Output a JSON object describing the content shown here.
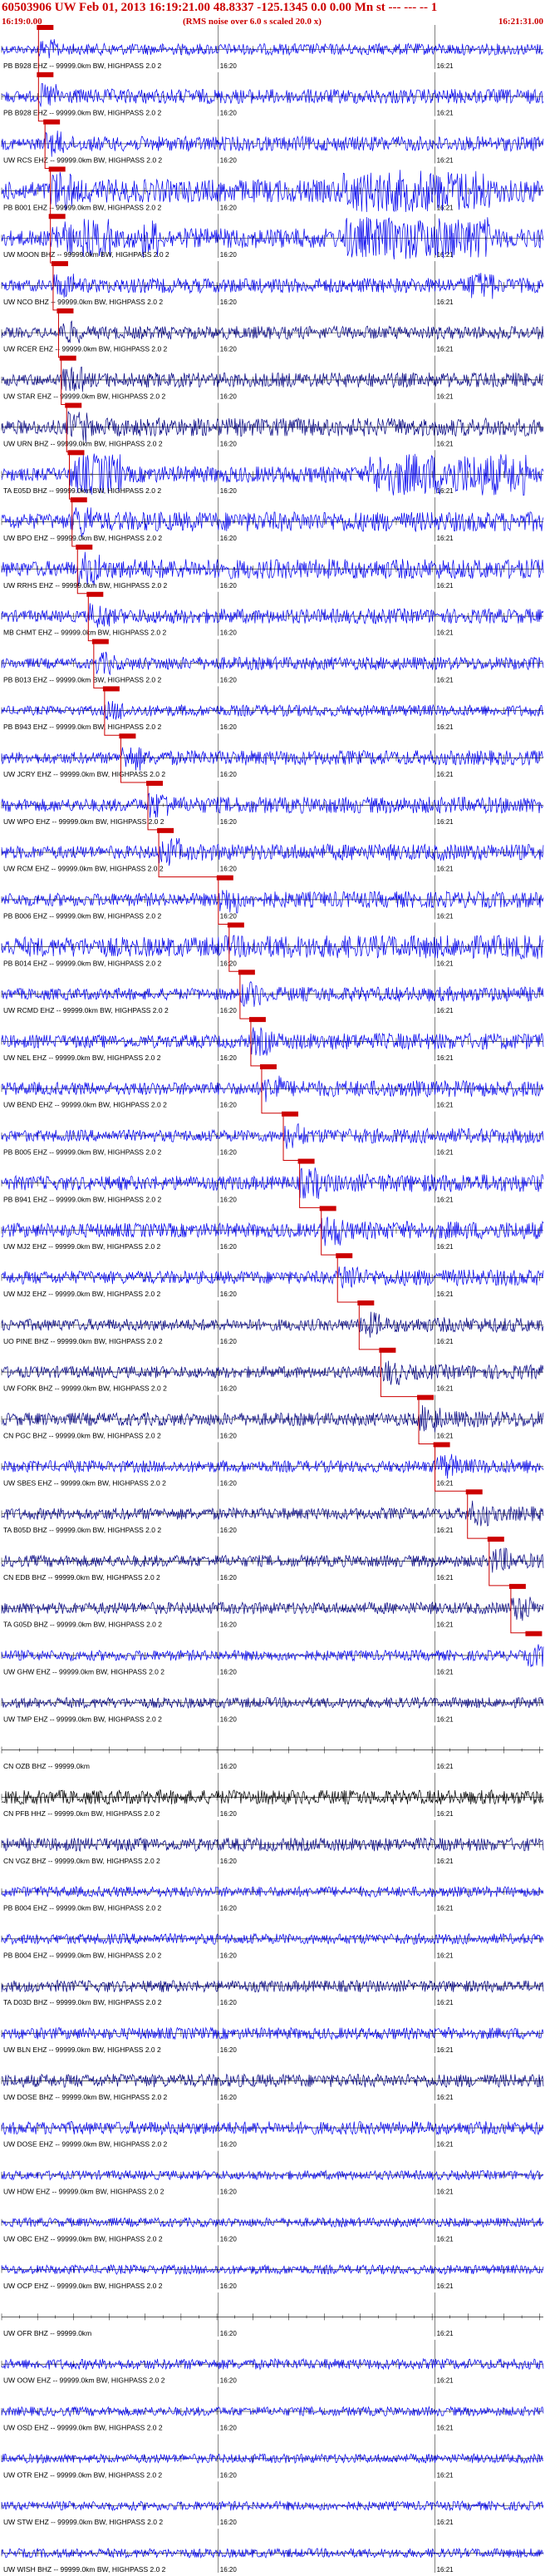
{
  "header": {
    "title": "60503906 UW Feb 01, 2013 16:19:21.00   48.8337 -125.1345  0.0 0.00 Mn st --- --- -- 1",
    "start_time": "16:19:0.00",
    "rms_note": "(RMS noise over 6.0 s scaled 20.0 x)",
    "end_time": "16:21:31.00"
  },
  "chart_data": {
    "type": "line",
    "title": "60503906 UW Feb 01, 2013 16:19:21.00   48.8337 -125.1345  0.0 0.00 Mn st --- --- -- 1",
    "x_range": [
      "16:19:00",
      "16:21:31"
    ],
    "tick_labels": [
      "16:20",
      "16:21"
    ],
    "grid": true,
    "colors": {
      "blue": "#0000ee",
      "navy": "#000080",
      "black": "#000000",
      "red": "#cc0000",
      "trace_dark": "#1a0066"
    },
    "series": [
      {
        "name": "PB B928 EHZ -- 99999.0km BW, HIGHPASS  2.0  2",
        "color": "blue",
        "amp": 0.35,
        "pick": 0.068,
        "bursts": []
      },
      {
        "name": "PB B928 EHZ -- 99999.0km BW, HIGHPASS  2.0  2",
        "color": "blue",
        "amp": 0.45,
        "pick": 0.068,
        "bursts": []
      },
      {
        "name": "UW RCS EHZ -- 99999.0km BW, HIGHPASS  2.0  2",
        "color": "blue",
        "amp": 0.45,
        "pick": 0.08,
        "bursts": []
      },
      {
        "name": "PB B001 EHZ -- 99999.0km BW, HIGHPASS  2.0  2",
        "color": "blue",
        "amp": 0.7,
        "pick": 0.09,
        "bursts": [
          [
            0.63,
            0.9,
            2.4
          ]
        ]
      },
      {
        "name": "UW MOON BHZ -- 99999.0km BW, HIGHPASS  2.0  2",
        "color": "blue",
        "amp": 0.6,
        "pick": 0.09,
        "bursts": [
          [
            0.15,
            0.2,
            2.2
          ],
          [
            0.26,
            0.29,
            2.2
          ],
          [
            0.63,
            0.9,
            2.4
          ]
        ]
      },
      {
        "name": "UW NCO BHZ -- 99999.0km BW, HIGHPASS  2.0  2",
        "color": "blue",
        "amp": 0.45,
        "pick": 0.095,
        "bursts": [
          [
            0.86,
            0.91,
            1.6
          ]
        ]
      },
      {
        "name": "UW RCER EHZ -- 99999.0km BW, HIGHPASS  2.0  2",
        "color": "navy",
        "amp": 0.4,
        "pick": 0.105,
        "bursts": []
      },
      {
        "name": "UW STAR EHZ -- 99999.0km BW, HIGHPASS  2.0  2",
        "color": "navy",
        "amp": 0.45,
        "pick": 0.11,
        "bursts": []
      },
      {
        "name": "UW URN BHZ -- 99999.0km BW, HIGHPASS  2.0  2",
        "color": "navy",
        "amp": 0.55,
        "pick": 0.12,
        "bursts": []
      },
      {
        "name": "TA E05D BHZ -- 99999.0km BW, HIGHPASS  2.0  2",
        "color": "blue",
        "amp": 0.5,
        "pick": 0.125,
        "bursts": [
          [
            0.14,
            0.22,
            2.4
          ],
          [
            0.68,
            0.97,
            2.4
          ]
        ]
      },
      {
        "name": "UW BPO EHZ -- 99999.0km BW, HIGHPASS  2.0  2",
        "color": "blue",
        "amp": 0.6,
        "pick": 0.13,
        "bursts": []
      },
      {
        "name": "UW RRHS EHZ -- 99999.0km BW, HIGHPASS  2.0  2",
        "color": "blue",
        "amp": 0.6,
        "pick": 0.14,
        "bursts": []
      },
      {
        "name": "MB CHMT EHZ -- 99999.0km BW, HIGHPASS  2.0  2",
        "color": "blue",
        "amp": 0.45,
        "pick": 0.16,
        "bursts": []
      },
      {
        "name": "PB B013 EHZ -- 99999.0km BW, HIGHPASS  2.0  2",
        "color": "blue",
        "amp": 0.4,
        "pick": 0.17,
        "bursts": []
      },
      {
        "name": "PB B943 EHZ -- 99999.0km BW, HIGHPASS  2.0  2",
        "color": "blue",
        "amp": 0.35,
        "pick": 0.19,
        "bursts": []
      },
      {
        "name": "UW JCRY EHZ -- 99999.0km BW, HIGHPASS  2.0  2",
        "color": "blue",
        "amp": 0.45,
        "pick": 0.22,
        "bursts": []
      },
      {
        "name": "UW WPO EHZ -- 99999.0km BW, HIGHPASS  2.0  2",
        "color": "blue",
        "amp": 0.5,
        "pick": 0.27,
        "bursts": []
      },
      {
        "name": "UW RCM EHZ -- 99999.0km BW, HIGHPASS  2.0  2",
        "color": "blue",
        "amp": 0.5,
        "pick": 0.29,
        "bursts": []
      },
      {
        "name": "PB B006 EHZ -- 99999.0km BW, HIGHPASS  2.0  2",
        "color": "blue",
        "amp": 0.5,
        "pick": 0.4,
        "bursts": []
      },
      {
        "name": "PB B014 EHZ -- 99999.0km BW, HIGHPASS  2.0  2",
        "color": "blue",
        "amp": 0.75,
        "pick": 0.42,
        "bursts": [
          [
            0.4,
            0.95,
            1.3
          ]
        ]
      },
      {
        "name": "UW RCMD EHZ -- 99999.0km BW, HIGHPASS  2.0  2",
        "color": "blue",
        "amp": 0.45,
        "pick": 0.44,
        "bursts": []
      },
      {
        "name": "UW NEL EHZ -- 99999.0km BW, HIGHPASS  2.0  2",
        "color": "blue",
        "amp": 0.5,
        "pick": 0.46,
        "bursts": []
      },
      {
        "name": "UW BEND EHZ -- 99999.0km BW, HIGHPASS  2.0  2",
        "color": "blue",
        "amp": 0.5,
        "pick": 0.48,
        "bursts": []
      },
      {
        "name": "PB B005 EHZ -- 99999.0km BW, HIGHPASS  2.0  2",
        "color": "blue",
        "amp": 0.45,
        "pick": 0.52,
        "bursts": []
      },
      {
        "name": "PB B941 EHZ -- 99999.0km BW, HIGHPASS  2.0  2",
        "color": "blue",
        "amp": 0.55,
        "pick": 0.55,
        "bursts": []
      },
      {
        "name": "UW MJ2 EHZ -- 99999.0km BW, HIGHPASS  2.0  2",
        "color": "blue",
        "amp": 0.55,
        "pick": 0.59,
        "bursts": []
      },
      {
        "name": "UW MJ2 EHZ -- 99999.0km BW, HIGHPASS  2.0  2",
        "color": "blue",
        "amp": 0.5,
        "pick": 0.62,
        "bursts": []
      },
      {
        "name": "UO PINE BHZ -- 99999.0km BW, HIGHPASS  2.0  2",
        "color": "navy",
        "amp": 0.45,
        "pick": 0.66,
        "bursts": []
      },
      {
        "name": "UW FORK BHZ -- 99999.0km BW, HIGHPASS  2.0  2",
        "color": "navy",
        "amp": 0.45,
        "pick": 0.7,
        "bursts": []
      },
      {
        "name": "CN PGC BHZ -- 99999.0km BW, HIGHPASS  2.0  2",
        "color": "navy",
        "amp": 0.5,
        "pick": 0.77,
        "bursts": []
      },
      {
        "name": "UW SBES EHZ -- 99999.0km BW, HIGHPASS  2.0  2",
        "color": "blue",
        "amp": 0.45,
        "pick": 0.8,
        "bursts": []
      },
      {
        "name": "TA B05D BHZ -- 99999.0km BW, HIGHPASS  2.0  2",
        "color": "navy",
        "amp": 0.45,
        "pick": 0.86,
        "bursts": []
      },
      {
        "name": "CN EDB BHZ -- 99999.0km BW, HIGHPASS  2.0  2",
        "color": "navy",
        "amp": 0.45,
        "pick": 0.9,
        "bursts": []
      },
      {
        "name": "TA G05D BHZ -- 99999.0km BW, HIGHPASS  2.0  2",
        "color": "navy",
        "amp": 0.45,
        "pick": 0.94,
        "bursts": []
      },
      {
        "name": "UW GHW EHZ -- 99999.0km BW, HIGHPASS  2.0  2",
        "color": "blue",
        "amp": 0.4,
        "pick": 0.97,
        "bursts": []
      },
      {
        "name": "UW TMP EHZ -- 99999.0km BW, HIGHPASS  2.0  2",
        "color": "navy",
        "amp": 0.4,
        "pick": null,
        "bursts": []
      },
      {
        "name": "CN OZB BHZ -- 99999.0km",
        "color": "black",
        "amp": 0.0,
        "pick": null,
        "bursts": []
      },
      {
        "name": "CN PFB HHZ -- 99999.0km BW, HIGHPASS  2.0  2",
        "color": "black",
        "amp": 0.55,
        "pick": null,
        "bursts": []
      },
      {
        "name": "CN VGZ BHZ -- 99999.0km BW, HIGHPASS  2.0  2",
        "color": "navy",
        "amp": 0.5,
        "pick": null,
        "bursts": []
      },
      {
        "name": "PB B004 EHZ -- 99999.0km BW, HIGHPASS  2.0  2",
        "color": "blue",
        "amp": 0.4,
        "pick": null,
        "bursts": []
      },
      {
        "name": "PB B004 EHZ -- 99999.0km BW, HIGHPASS  2.0  2",
        "color": "blue",
        "amp": 0.4,
        "pick": null,
        "bursts": []
      },
      {
        "name": "TA D03D BHZ -- 99999.0km BW, HIGHPASS  2.0  2",
        "color": "navy",
        "amp": 0.45,
        "pick": null,
        "bursts": []
      },
      {
        "name": "UW BLN EHZ -- 99999.0km BW, HIGHPASS  2.0  2",
        "color": "blue",
        "amp": 0.45,
        "pick": null,
        "bursts": []
      },
      {
        "name": "UW DOSE BHZ -- 99999.0km BW, HIGHPASS  2.0  2",
        "color": "navy",
        "amp": 0.5,
        "pick": null,
        "bursts": []
      },
      {
        "name": "UW DOSE EHZ -- 99999.0km BW, HIGHPASS  2.0  2",
        "color": "blue",
        "amp": 0.5,
        "pick": null,
        "bursts": []
      },
      {
        "name": "UW HDW EHZ -- 99999.0km BW, HIGHPASS  2.0  2",
        "color": "blue",
        "amp": 0.35,
        "pick": null,
        "bursts": []
      },
      {
        "name": "UW OBC EHZ -- 99999.0km BW, HIGHPASS  2.0  2",
        "color": "blue",
        "amp": 0.35,
        "pick": null,
        "bursts": []
      },
      {
        "name": "UW OCP EHZ -- 99999.0km BW, HIGHPASS  2.0  2",
        "color": "blue",
        "amp": 0.35,
        "pick": null,
        "bursts": []
      },
      {
        "name": "UW OFR BHZ -- 99999.0km",
        "color": "navy",
        "amp": 0.0,
        "pick": null,
        "bursts": []
      },
      {
        "name": "UW OOW EHZ -- 99999.0km BW, HIGHPASS  2.0  2",
        "color": "blue",
        "amp": 0.4,
        "pick": null,
        "bursts": []
      },
      {
        "name": "UW OSD EHZ -- 99999.0km BW, HIGHPASS  2.0  2",
        "color": "blue",
        "amp": 0.35,
        "pick": null,
        "bursts": []
      },
      {
        "name": "UW OTR EHZ -- 99999.0km BW, HIGHPASS  2.0  2",
        "color": "blue",
        "amp": 0.35,
        "pick": null,
        "bursts": []
      },
      {
        "name": "UW STW EHZ -- 99999.0km BW, HIGHPASS  2.0  2",
        "color": "blue",
        "amp": 0.35,
        "pick": null,
        "bursts": []
      },
      {
        "name": "UW WISH BHZ -- 99999.0km BW, HIGHPASS  2.0  2",
        "color": "blue",
        "amp": 0.35,
        "pick": null,
        "bursts": []
      }
    ]
  }
}
